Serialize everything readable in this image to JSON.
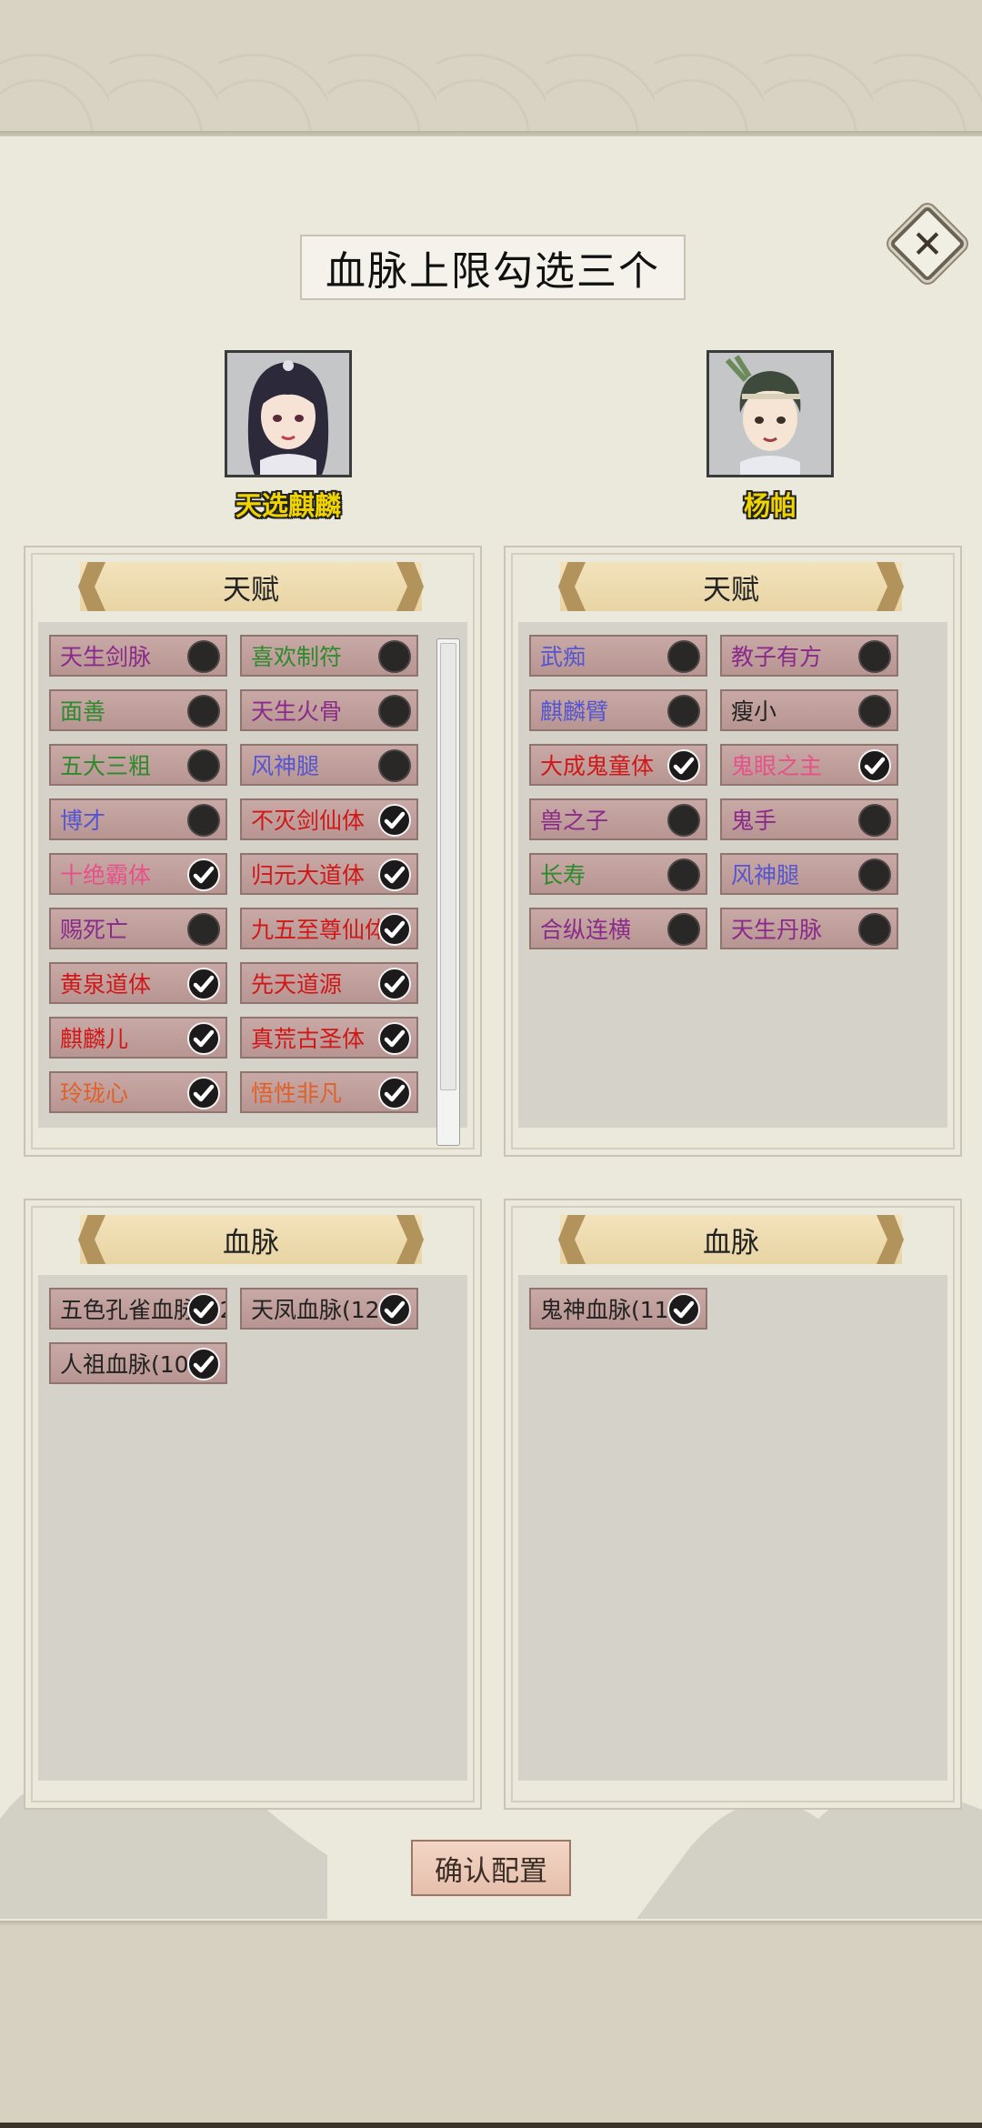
{
  "title": "血脉上限勾选三个",
  "close_icon": "close-x-icon",
  "characters": [
    {
      "name": "天选麒麟",
      "avatar": "female-portrait"
    },
    {
      "name": "杨帕",
      "avatar": "male-portrait"
    }
  ],
  "left_talent_panel": {
    "header": "天赋",
    "items": [
      {
        "label": "天生剑脉",
        "color": "#8a2a8a",
        "checked": false
      },
      {
        "label": "喜欢制符",
        "color": "#2d8a2d",
        "checked": false
      },
      {
        "label": "面善",
        "color": "#2d8a2d",
        "checked": false
      },
      {
        "label": "天生火骨",
        "color": "#8a2a8a",
        "checked": false
      },
      {
        "label": "五大三粗",
        "color": "#2d8a2d",
        "checked": false
      },
      {
        "label": "风神腿",
        "color": "#5555d0",
        "checked": false
      },
      {
        "label": "博才",
        "color": "#5555d0",
        "checked": false
      },
      {
        "label": "不灭剑仙体",
        "color": "#d01818",
        "checked": true
      },
      {
        "label": "十绝霸体",
        "color": "#e8508a",
        "checked": true
      },
      {
        "label": "归元大道体",
        "color": "#d01818",
        "checked": true
      },
      {
        "label": "赐死亡",
        "color": "#8a2a8a",
        "checked": false
      },
      {
        "label": "九五至尊仙体",
        "color": "#d01818",
        "checked": true
      },
      {
        "label": "黄泉道体",
        "color": "#d01818",
        "checked": true
      },
      {
        "label": "先天道源",
        "color": "#d01818",
        "checked": true
      },
      {
        "label": "麒麟儿",
        "color": "#d01818",
        "checked": true
      },
      {
        "label": "真荒古圣体",
        "color": "#d01818",
        "checked": true
      },
      {
        "label": "玲珑心",
        "color": "#e0602a",
        "checked": true
      },
      {
        "label": "悟性非凡",
        "color": "#e0602a",
        "checked": true
      }
    ]
  },
  "right_talent_panel": {
    "header": "天赋",
    "items": [
      {
        "label": "武痴",
        "color": "#5555d0",
        "checked": false
      },
      {
        "label": "教子有方",
        "color": "#8a2a8a",
        "checked": false
      },
      {
        "label": "麒麟臂",
        "color": "#5555d0",
        "checked": false
      },
      {
        "label": "瘦小",
        "color": "#222222",
        "checked": false
      },
      {
        "label": "大成鬼童体",
        "color": "#d01818",
        "checked": true
      },
      {
        "label": "鬼眼之主",
        "color": "#e8508a",
        "checked": true
      },
      {
        "label": "兽之子",
        "color": "#8a2a8a",
        "checked": false
      },
      {
        "label": "鬼手",
        "color": "#8a2a8a",
        "checked": false
      },
      {
        "label": "长寿",
        "color": "#2d8a2d",
        "checked": false
      },
      {
        "label": "风神腿",
        "color": "#5555d0",
        "checked": false
      },
      {
        "label": "合纵连横",
        "color": "#8a2a8a",
        "checked": false
      },
      {
        "label": "天生丹脉",
        "color": "#8a2a8a",
        "checked": false
      }
    ]
  },
  "left_blood_panel": {
    "header": "血脉",
    "items": [
      {
        "label": "五色孔雀血脉(12",
        "color": "#222222",
        "checked": true
      },
      {
        "label": "天凤血脉(12",
        "color": "#222222",
        "checked": true
      },
      {
        "label": "人祖血脉(10",
        "color": "#222222",
        "checked": true
      }
    ]
  },
  "right_blood_panel": {
    "header": "血脉",
    "items": [
      {
        "label": "鬼神血脉(11",
        "color": "#222222",
        "checked": true
      }
    ]
  },
  "confirm_label": "确认配置"
}
